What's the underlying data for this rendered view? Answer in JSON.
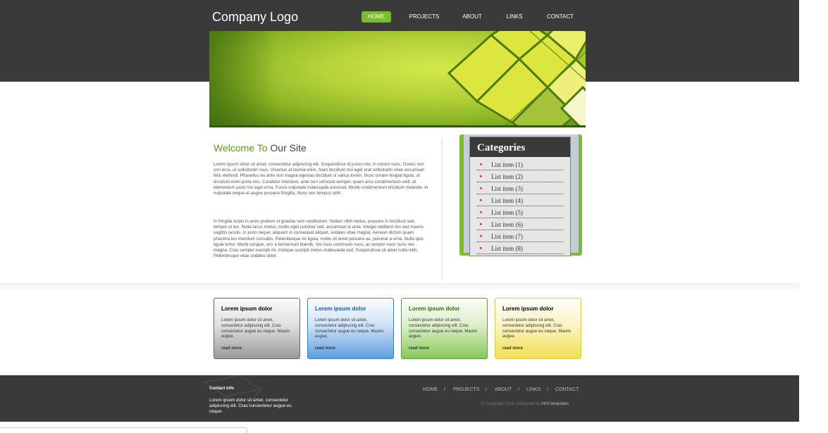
{
  "header": {
    "logo": "Company Logo",
    "nav": [
      {
        "label": "HOME",
        "active": true
      },
      {
        "label": "PROJECTS",
        "active": false
      },
      {
        "label": "ABOUT",
        "active": false
      },
      {
        "label": "LINKS",
        "active": false
      },
      {
        "label": "CONTACT",
        "active": false
      }
    ]
  },
  "main": {
    "welcome_green": "Welcome To",
    "welcome_rest": "Our Site",
    "paragraph1": "Lorem ipsum dolor sit amet, consectetur adipiscing elit. Suspendisse id purus nisi, in rutrum nunc. Donec non orci eros, ut sollicitudin risus. Vivamus at lacinia enim. Nam tincidunt nisi eget erat sollicitudin vitae accumsan felis eleifend. Phasellus eu ante non magna egestas tincidunt ut varius lorem. Nunc ornare feugiat ligula, ut tincidunt enim porta nec. Curabitur interdum, ante non vehicula semper, quam arcu condimentum velit, at elementum justo nisi eget urna. Fusce vulputate malesuada euismod. Morbi condimentum tincidunt molestie. In vulputate neque et augue posuere fringilla. Nunc nec tempus nibh.",
    "paragraph2": "In fringilla turpis in enim pretium et gravida sem vestibulum. Nullam nibh metus, posuere in tincidunt sed, tempor ut leo. Nulla lacus metus, mollis eget pulvinar sed, accumsan ut ante. Integer eleifend nisi sed mauris sagittis iaculis. In justo neque, aliquam in consequat aliquet, sodales vitae magna. Aenean dictum quam pharetra leo interdum convallis. Pellentesque mi ligula, mollis sit amet posuere ac, pulvinar a urna. Nulla quis ligula tortor. Morbi congue, orci a fermentum blandit, nisl risus commodo nunc, ac tempor nunc nunc nec magna. Cras semper suscipit mi, tristique suscipit metus malesuada sed. Suspendisse sit amet nulla nibh. Pellentesque vitae sodales dolor."
  },
  "sidebar": {
    "title": "Categories",
    "items": [
      "List item (1)",
      "List item (2)",
      "List item (3)",
      "List item (4)",
      "List item (5)",
      "List item (6)",
      "List item (7)",
      "List item (8)"
    ]
  },
  "cards": [
    {
      "title": "Lorem ipsum dolor",
      "body": "Lorem ipsum dolor sit amet, consectetur adipiscing elit. Cras consectetur augue eu neque. Mauris augue.",
      "link": "read more",
      "theme": "gray",
      "title_color": "#222222"
    },
    {
      "title": "Lorem ipsum dolor",
      "body": "Lorem ipsum dolor sit amet, consectetur adipiscing elit. Cras consectetur augue eu neque. Mauris augue.",
      "link": "read more",
      "theme": "blue",
      "title_color": "#1a5aa8"
    },
    {
      "title": "Lorem ipsum dolor",
      "body": "Lorem ipsum dolor sit amet, consectetur adipiscing elit. Cras consectetur augue eu neque. Mauris augue.",
      "link": "read more",
      "theme": "green",
      "title_color": "#2f6d10"
    },
    {
      "title": "Lorem ipsum dolor",
      "body": "Lorem ipsum dolor sit amet, consectetur adipiscing elit. Cras consectetur augue eu neque. Mauris augue.",
      "link": "read more",
      "theme": "yellow",
      "title_color": "#222222"
    }
  ],
  "footer": {
    "contact_title": "Contact info",
    "contact_text": "Lorem ipsum dolor sit amet, consectetur adipiscing elit. Cras consectetur augue eu neque.",
    "nav": [
      "HOME",
      "PROJECTS",
      "ABOUT",
      "LINKS",
      "CONTACT"
    ],
    "separator": "/",
    "copyright": "© Copyright 2014. Designed by",
    "designer": "html templates"
  },
  "colors": {
    "header_bg": "#3a3a3a",
    "accent_green": "#79bd2b",
    "bullet_red": "#d8232a"
  }
}
